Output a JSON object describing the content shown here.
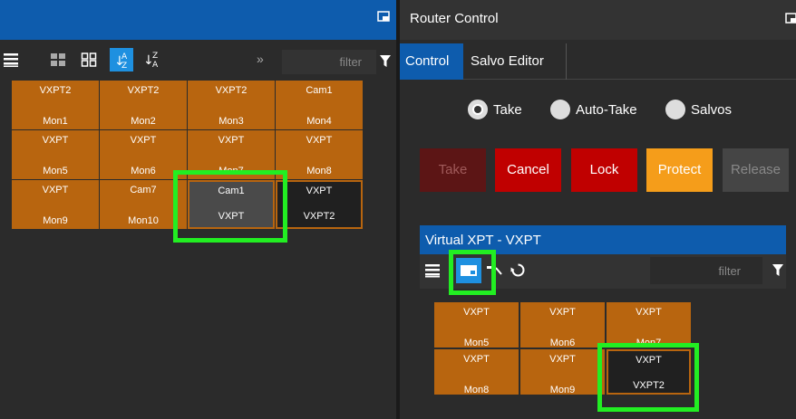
{
  "left": {
    "filter_placeholder": "filter",
    "expand_label": "»",
    "tiles": [
      {
        "top": "VXPT2",
        "bottom": "Mon1",
        "style": "orange"
      },
      {
        "top": "VXPT2",
        "bottom": "Mon2",
        "style": "orange"
      },
      {
        "top": "VXPT2",
        "bottom": "Mon3",
        "style": "orange"
      },
      {
        "top": "Cam1",
        "bottom": "Mon4",
        "style": "orange"
      },
      {
        "top": "VXPT",
        "bottom": "Mon5",
        "style": "orange"
      },
      {
        "top": "VXPT",
        "bottom": "Mon6",
        "style": "orange"
      },
      {
        "top": "VXPT",
        "bottom": "Mon7",
        "style": "orange"
      },
      {
        "top": "VXPT",
        "bottom": "Mon8",
        "style": "orange"
      },
      {
        "top": "VXPT",
        "bottom": "Mon9",
        "style": "orange"
      },
      {
        "top": "Cam7",
        "bottom": "Mon10",
        "style": "orange"
      },
      {
        "top": "Cam1",
        "bottom": "VXPT",
        "style": "gray"
      },
      {
        "top": "VXPT",
        "bottom": "VXPT2",
        "style": "dark"
      }
    ]
  },
  "right": {
    "title": "Router Control",
    "tabs": [
      "Control",
      "Salvo Editor"
    ],
    "radios": [
      {
        "label": "Take",
        "checked": true
      },
      {
        "label": "Auto-Take",
        "checked": false
      },
      {
        "label": "Salvos",
        "checked": false
      }
    ],
    "buttons": {
      "take": "Take",
      "cancel": "Cancel",
      "lock": "Lock",
      "protect": "Protect",
      "release": "Release"
    },
    "vxpt_header": "Virtual XPT - VXPT",
    "filter_placeholder": "filter",
    "vxpt_tiles": [
      {
        "top": "VXPT",
        "bottom": "Mon5",
        "style": "orange"
      },
      {
        "top": "VXPT",
        "bottom": "Mon6",
        "style": "orange"
      },
      {
        "top": "VXPT",
        "bottom": "Mon7",
        "style": "orange"
      },
      {
        "top": "VXPT",
        "bottom": "Mon8",
        "style": "orange"
      },
      {
        "top": "VXPT",
        "bottom": "Mon9",
        "style": "orange"
      },
      {
        "top": "VXPT",
        "bottom": "VXPT2",
        "style": "dark"
      }
    ]
  },
  "colors": {
    "accent_blue": "#0e5cad",
    "tile_orange": "#b8650f",
    "highlight_green": "#22ee22",
    "cancel_red": "#c00000",
    "protect_orange": "#f59d1a"
  }
}
